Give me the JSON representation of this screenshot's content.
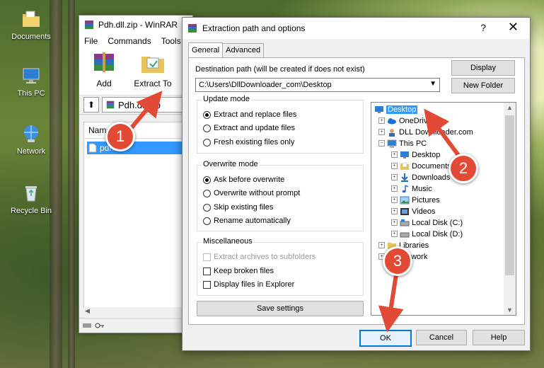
{
  "desktop": {
    "icons": [
      {
        "label": "Documents",
        "icon": "folder-documents-icon"
      },
      {
        "label": "This PC",
        "icon": "computer-icon"
      },
      {
        "label": "Network",
        "icon": "network-icon"
      },
      {
        "label": "Recycle Bin",
        "icon": "recycle-bin-icon"
      }
    ]
  },
  "winrar": {
    "title": "Pdh.dll.zip - WinRAR",
    "menu": [
      "File",
      "Commands",
      "Tools"
    ],
    "toolbar": {
      "add_label": "Add",
      "extract_label": "Extract To"
    },
    "address": "Pdh.dll.zip",
    "column_name": "Name",
    "selected_file": "pdh"
  },
  "dialog": {
    "title": "Extraction path and options",
    "help_label": "?",
    "close_label": "✕",
    "tabs": [
      {
        "label": "General"
      },
      {
        "label": "Advanced"
      }
    ],
    "destination_label": "Destination path (will be created if does not exist)",
    "destination_value": "C:\\Users\\DllDownloader_com\\Desktop",
    "display_button": "Display",
    "new_folder_button": "New Folder",
    "update_mode": {
      "title": "Update mode",
      "options": [
        "Extract and replace files",
        "Extract and update files",
        "Fresh existing files only"
      ],
      "selected": 0
    },
    "overwrite_mode": {
      "title": "Overwrite mode",
      "options": [
        "Ask before overwrite",
        "Overwrite without prompt",
        "Skip existing files",
        "Rename automatically"
      ],
      "selected": 0
    },
    "misc": {
      "title": "Miscellaneous",
      "options": [
        {
          "label": "Extract archives to subfolders",
          "disabled": true,
          "checked": false
        },
        {
          "label": "Keep broken files",
          "disabled": false,
          "checked": false
        },
        {
          "label": "Display files in Explorer",
          "disabled": false,
          "checked": false
        }
      ]
    },
    "save_settings_button": "Save settings",
    "tree": [
      {
        "label": "Desktop",
        "selected": true
      },
      {
        "label": "OneDrive"
      },
      {
        "label": "DLL Downloader.com"
      },
      {
        "label": "This PC"
      },
      {
        "label": "Desktop"
      },
      {
        "label": "Documents"
      },
      {
        "label": "Downloads"
      },
      {
        "label": "Music"
      },
      {
        "label": "Pictures"
      },
      {
        "label": "Videos"
      },
      {
        "label": "Local Disk (C:)"
      },
      {
        "label": "Local Disk (D:)"
      },
      {
        "label": "Libraries"
      },
      {
        "label": "Network"
      }
    ],
    "ok_button": "OK",
    "cancel_button": "Cancel",
    "help_button": "Help"
  },
  "callouts": [
    "1",
    "2",
    "3"
  ],
  "colors": {
    "accent": "#3399ff",
    "callout": "#e34a36",
    "arrow": "#e34a36"
  }
}
